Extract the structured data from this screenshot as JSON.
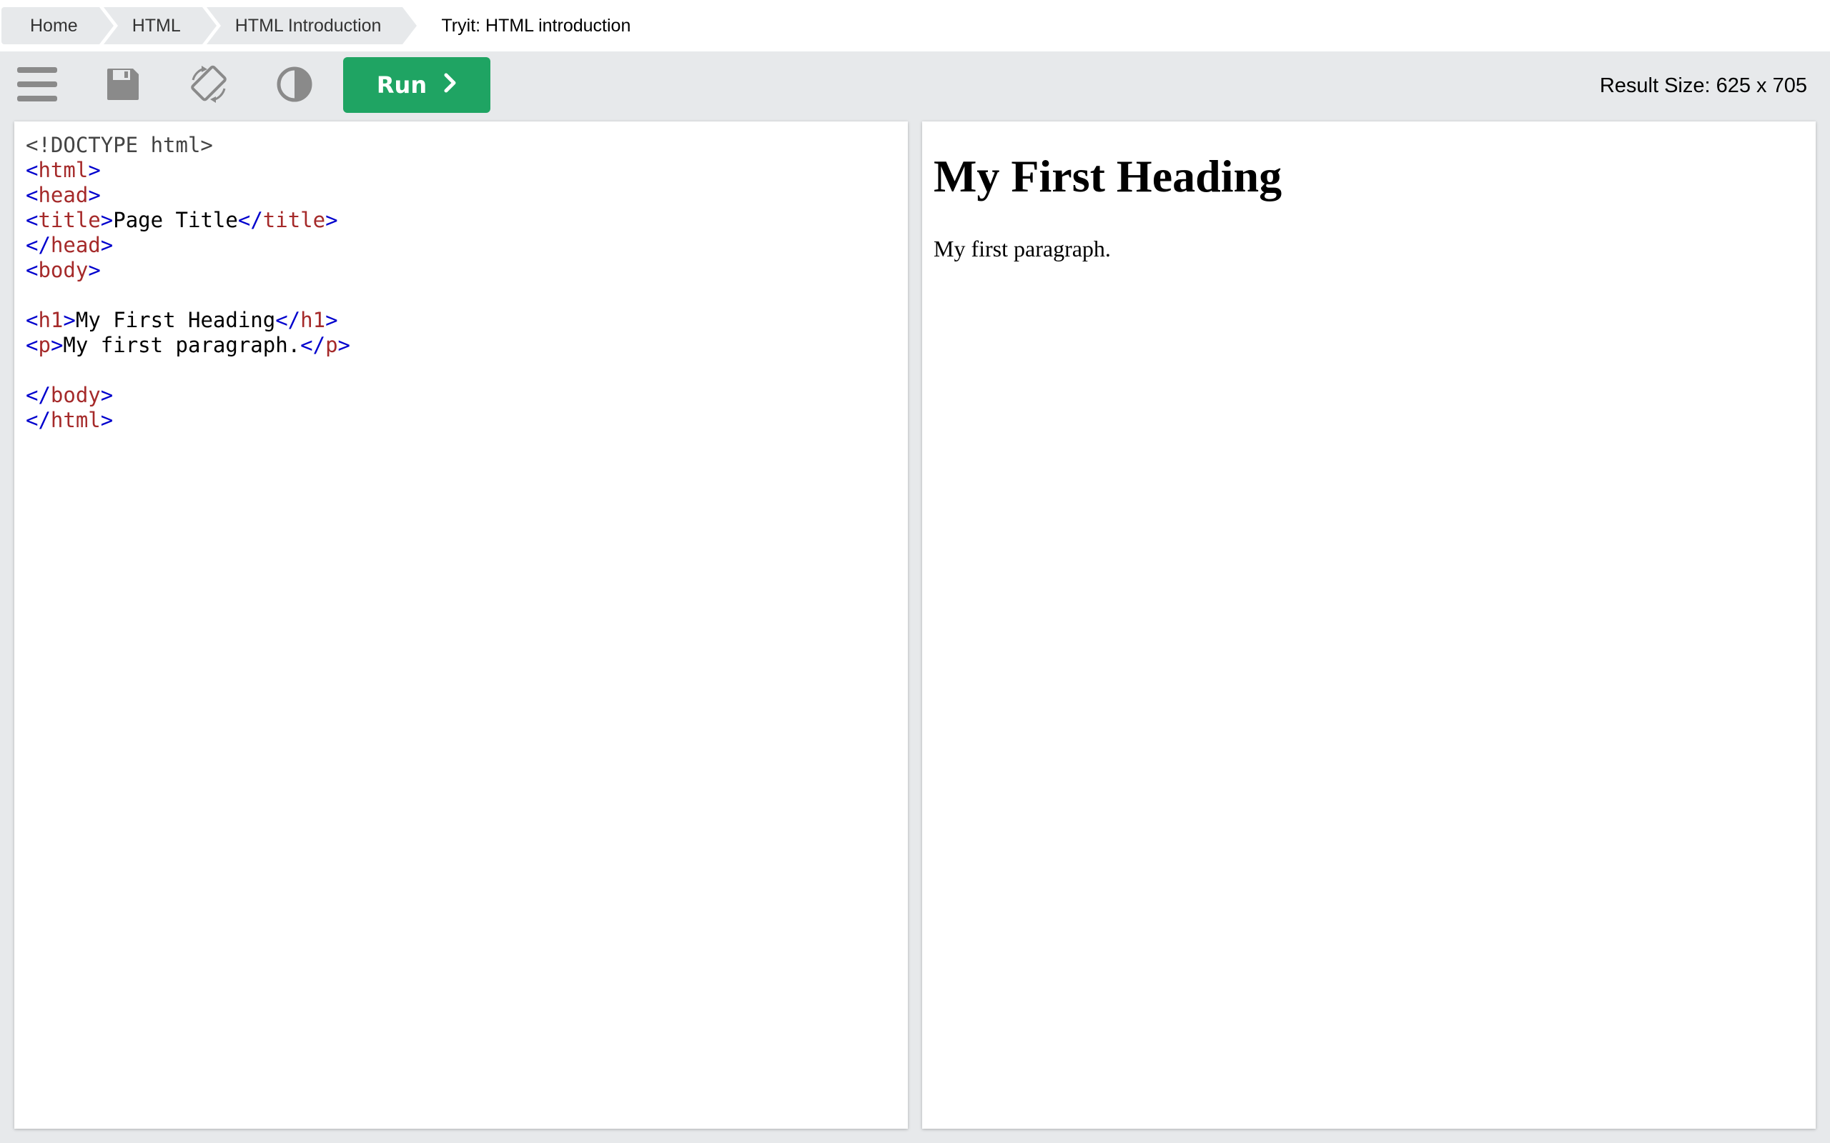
{
  "breadcrumb": {
    "items": [
      {
        "label": "Home"
      },
      {
        "label": "HTML"
      },
      {
        "label": "HTML Introduction"
      },
      {
        "label": "Tryit: HTML introduction"
      }
    ]
  },
  "toolbar": {
    "icons": [
      "menu-icon",
      "save-icon",
      "rotate-icon",
      "contrast-icon"
    ],
    "run_label": "Run",
    "result_size": "Result Size: 625 x 705"
  },
  "editor": {
    "lines": [
      [
        {
          "t": "doc",
          "v": "<!DOCTYPE html>"
        }
      ],
      [
        {
          "t": "br",
          "v": "<"
        },
        {
          "t": "tag",
          "v": "html"
        },
        {
          "t": "br",
          "v": ">"
        }
      ],
      [
        {
          "t": "br",
          "v": "<"
        },
        {
          "t": "tag",
          "v": "head"
        },
        {
          "t": "br",
          "v": ">"
        }
      ],
      [
        {
          "t": "br",
          "v": "<"
        },
        {
          "t": "tag",
          "v": "title"
        },
        {
          "t": "br",
          "v": ">"
        },
        {
          "t": "txt",
          "v": "Page Title"
        },
        {
          "t": "br",
          "v": "</"
        },
        {
          "t": "tag",
          "v": "title"
        },
        {
          "t": "br",
          "v": ">"
        }
      ],
      [
        {
          "t": "br",
          "v": "</"
        },
        {
          "t": "tag",
          "v": "head"
        },
        {
          "t": "br",
          "v": ">"
        }
      ],
      [
        {
          "t": "br",
          "v": "<"
        },
        {
          "t": "tag",
          "v": "body"
        },
        {
          "t": "br",
          "v": ">"
        }
      ],
      [],
      [
        {
          "t": "br",
          "v": "<"
        },
        {
          "t": "tag",
          "v": "h1"
        },
        {
          "t": "br",
          "v": ">"
        },
        {
          "t": "txt",
          "v": "My First Heading"
        },
        {
          "t": "br",
          "v": "</"
        },
        {
          "t": "tag",
          "v": "h1"
        },
        {
          "t": "br",
          "v": ">"
        }
      ],
      [
        {
          "t": "br",
          "v": "<"
        },
        {
          "t": "tag",
          "v": "p"
        },
        {
          "t": "br",
          "v": ">"
        },
        {
          "t": "txt",
          "v": "My first paragraph."
        },
        {
          "t": "br",
          "v": "</"
        },
        {
          "t": "tag",
          "v": "p"
        },
        {
          "t": "br",
          "v": ">"
        }
      ],
      [],
      [
        {
          "t": "br",
          "v": "</"
        },
        {
          "t": "tag",
          "v": "body"
        },
        {
          "t": "br",
          "v": ">"
        }
      ],
      [
        {
          "t": "br",
          "v": "</"
        },
        {
          "t": "tag",
          "v": "html"
        },
        {
          "t": "br",
          "v": ">"
        }
      ]
    ]
  },
  "result": {
    "heading": "My First Heading",
    "paragraph": "My first paragraph."
  },
  "colors": {
    "run_button": "#1fa463",
    "bracket": "#0000cd",
    "tag": "#a52a2a",
    "toolbar_bg": "#e7e9eb"
  }
}
